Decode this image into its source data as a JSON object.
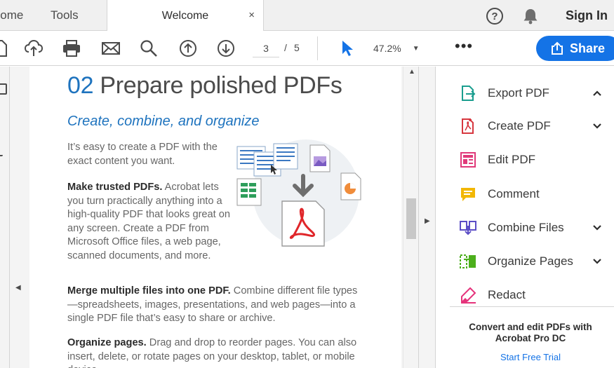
{
  "tabs": {
    "home": "Home",
    "tools": "Tools",
    "welcome": "Welcome",
    "close_glyph": "×"
  },
  "header": {
    "help_glyph": "?",
    "sign_in": "Sign In"
  },
  "toolbar": {
    "current_page": "3",
    "page_separator": "/",
    "total_pages": "5",
    "zoom": "47.2%",
    "zoom_arrow": "▼",
    "more_glyph": "•••",
    "share_label": "Share"
  },
  "document": {
    "heading_number": "02",
    "heading_text": "Prepare polished PDFs",
    "subheading": "Create, combine, and organize",
    "intro": "It’s easy to create a PDF with the exact content you want.",
    "trusted_bold": "Make trusted PDFs.",
    "trusted_text": " Acrobat lets you turn practically anything into a high-quality PDF that looks great on any screen. Create a PDF from Microsoft Office files, a web page, scanned documents, and more.",
    "merge_bold": "Merge multiple files into one PDF.",
    "merge_text": " Combine different file types—spreadsheets, images, presentations, and web pages—into a single PDF file that’s easy to share or archive.",
    "organize_bold": "Organize pages.",
    "organize_text": " Drag and drop to reorder pages. You can also insert, delete, or rotate pages on your desktop, tablet, or mobile device."
  },
  "right_panel": {
    "tools": [
      {
        "label": "Export PDF",
        "icon": "export-pdf-icon",
        "chevron": "up"
      },
      {
        "label": "Create PDF",
        "icon": "create-pdf-icon",
        "chevron": "down"
      },
      {
        "label": "Edit PDF",
        "icon": "edit-pdf-icon",
        "chevron": ""
      },
      {
        "label": "Comment",
        "icon": "comment-icon",
        "chevron": ""
      },
      {
        "label": "Combine Files",
        "icon": "combine-files-icon",
        "chevron": "down"
      },
      {
        "label": "Organize Pages",
        "icon": "organize-pages-icon",
        "chevron": "down"
      },
      {
        "label": "Redact",
        "icon": "redact-icon",
        "chevron": ""
      }
    ],
    "promo": "Convert and edit PDFs with Acrobat Pro DC",
    "trial_link": "Start Free Trial"
  },
  "colors": {
    "accent": "#1473e6",
    "heading_blue": "#1e73be",
    "export_teal": "#1b9e8f",
    "create_red": "#d7373f",
    "edit_pink": "#e03a7a",
    "comment_yellow": "#f2b705",
    "combine_purple": "#5c4ec6",
    "organize_green": "#4caf1c",
    "redact_pink": "#e5337b"
  }
}
